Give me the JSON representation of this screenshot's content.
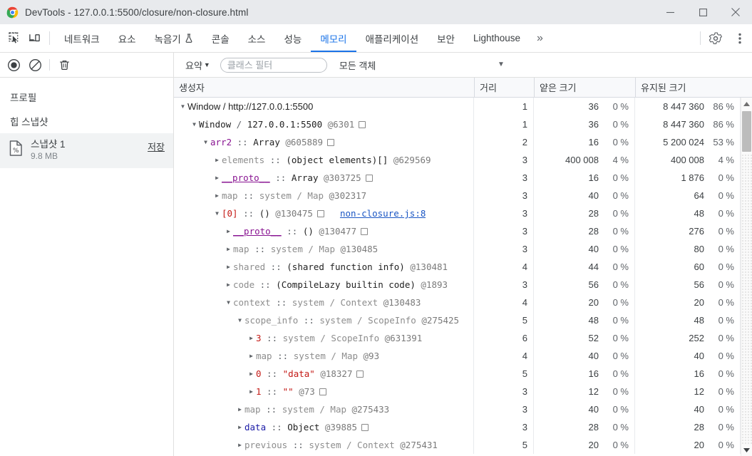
{
  "window": {
    "title": "DevTools - 127.0.0.1:5500/closure/non-closure.html",
    "minimize_label": "—",
    "maximize_label": "□",
    "close_label": "✕"
  },
  "tabbar": {
    "inspect_icon": "inspect-element-icon",
    "device_icon": "device-toolbar-icon",
    "tabs": [
      {
        "label": "네트워크",
        "active": false
      },
      {
        "label": "요소",
        "active": false
      },
      {
        "label": "녹음기",
        "active": false,
        "flask": true
      },
      {
        "label": "콘솔",
        "active": false
      },
      {
        "label": "소스",
        "active": false
      },
      {
        "label": "성능",
        "active": false
      },
      {
        "label": "메모리",
        "active": true
      },
      {
        "label": "애플리케이션",
        "active": false
      },
      {
        "label": "보안",
        "active": false
      },
      {
        "label": "Lighthouse",
        "active": false
      }
    ],
    "more_label": "»",
    "settings_icon": "gear-icon",
    "menu_icon": "more-vertical-icon"
  },
  "toolbar": {
    "record_icon": "record-icon",
    "clear_icon": "clear-icon",
    "trash_icon": "trash-icon",
    "view_select": "요약",
    "filter_placeholder": "클래스 필터",
    "filter_value": "",
    "object_select": "모든 객체",
    "caret": "▼"
  },
  "sidebar": {
    "profiles_title": "프로필",
    "section_title": "힙 스냅샷",
    "snapshot": {
      "icon": "snapshot-document-icon",
      "name": "스냅샷 1",
      "size": "9.8 MB",
      "save_label": "저장"
    }
  },
  "grid": {
    "columns": {
      "constructor": "생성자",
      "distance": "거리",
      "shallow": "얕은 크기",
      "retained": "유지된 크기"
    },
    "rows": [
      {
        "indent": 0,
        "twisty": "open",
        "topline": true,
        "parts": [
          {
            "t": "Window / http://127.0.0.1:5500",
            "c": "k-url"
          }
        ],
        "distance": "1",
        "shallow": "36",
        "shallow_pct": "0 %",
        "retained": "8 447 360",
        "retained_pct": "86 %"
      },
      {
        "indent": 1,
        "twisty": "open",
        "parts": [
          {
            "t": "Window",
            "c": "k-plain"
          },
          {
            "t": " / ",
            "c": "k-dim"
          },
          {
            "t": "127.0.0.1:5500",
            "c": "k-plain"
          },
          {
            "t": " @6301",
            "c": "k-id"
          },
          {
            "t": "box",
            "c": "winbox"
          }
        ],
        "distance": "1",
        "shallow": "36",
        "shallow_pct": "0 %",
        "retained": "8 447 360",
        "retained_pct": "86 %"
      },
      {
        "indent": 2,
        "twisty": "open",
        "parts": [
          {
            "t": "arr2",
            "c": "k-prop"
          },
          {
            "t": " :: ",
            "c": "k-dim"
          },
          {
            "t": "Array",
            "c": "k-plain"
          },
          {
            "t": " @605889",
            "c": "k-id"
          },
          {
            "t": "box",
            "c": "winbox"
          }
        ],
        "distance": "2",
        "shallow": "16",
        "shallow_pct": "0 %",
        "retained": "5 200 024",
        "retained_pct": "53 %"
      },
      {
        "indent": 3,
        "twisty": "closed",
        "parts": [
          {
            "t": "elements",
            "c": "k-sys"
          },
          {
            "t": " :: ",
            "c": "k-dim"
          },
          {
            "t": "(object elements)[]",
            "c": "k-plain"
          },
          {
            "t": " @629569",
            "c": "k-id"
          }
        ],
        "distance": "3",
        "shallow": "400 008",
        "shallow_pct": "4 %",
        "retained": "400 008",
        "retained_pct": "4 %"
      },
      {
        "indent": 3,
        "twisty": "closed",
        "parts": [
          {
            "t": "__proto__",
            "c": "k-prop-u"
          },
          {
            "t": " :: ",
            "c": "k-dim"
          },
          {
            "t": "Array",
            "c": "k-plain"
          },
          {
            "t": " @303725",
            "c": "k-id"
          },
          {
            "t": "box",
            "c": "winbox"
          }
        ],
        "distance": "3",
        "shallow": "16",
        "shallow_pct": "0 %",
        "retained": "1 876",
        "retained_pct": "0 %"
      },
      {
        "indent": 3,
        "twisty": "closed",
        "parts": [
          {
            "t": "map",
            "c": "k-sys"
          },
          {
            "t": " :: ",
            "c": "k-dim"
          },
          {
            "t": "system / Map",
            "c": "k-sys"
          },
          {
            "t": " @302317",
            "c": "k-id"
          }
        ],
        "distance": "3",
        "shallow": "40",
        "shallow_pct": "0 %",
        "retained": "64",
        "retained_pct": "0 %"
      },
      {
        "indent": 3,
        "twisty": "open",
        "parts": [
          {
            "t": "[0]",
            "c": "k-idx"
          },
          {
            "t": " :: ",
            "c": "k-dim"
          },
          {
            "t": "()",
            "c": "k-plain"
          },
          {
            "t": " @130475",
            "c": "k-id"
          },
          {
            "t": "box",
            "c": "winbox"
          },
          {
            "t": "non-closure.js:8",
            "c": "srclink"
          }
        ],
        "distance": "3",
        "shallow": "28",
        "shallow_pct": "0 %",
        "retained": "48",
        "retained_pct": "0 %"
      },
      {
        "indent": 4,
        "twisty": "closed",
        "parts": [
          {
            "t": "__proto__",
            "c": "k-prop-u"
          },
          {
            "t": " :: ",
            "c": "k-dim"
          },
          {
            "t": "()",
            "c": "k-plain"
          },
          {
            "t": " @130477",
            "c": "k-id"
          },
          {
            "t": "box",
            "c": "winbox"
          }
        ],
        "distance": "3",
        "shallow": "28",
        "shallow_pct": "0 %",
        "retained": "276",
        "retained_pct": "0 %"
      },
      {
        "indent": 4,
        "twisty": "closed",
        "parts": [
          {
            "t": "map",
            "c": "k-sys"
          },
          {
            "t": " :: ",
            "c": "k-dim"
          },
          {
            "t": "system / Map",
            "c": "k-sys"
          },
          {
            "t": " @130485",
            "c": "k-id"
          }
        ],
        "distance": "3",
        "shallow": "40",
        "shallow_pct": "0 %",
        "retained": "80",
        "retained_pct": "0 %"
      },
      {
        "indent": 4,
        "twisty": "closed",
        "parts": [
          {
            "t": "shared",
            "c": "k-sys"
          },
          {
            "t": " :: ",
            "c": "k-dim"
          },
          {
            "t": "(shared function info)",
            "c": "k-plain"
          },
          {
            "t": " @130481",
            "c": "k-id"
          }
        ],
        "distance": "4",
        "shallow": "44",
        "shallow_pct": "0 %",
        "retained": "60",
        "retained_pct": "0 %"
      },
      {
        "indent": 4,
        "twisty": "closed",
        "parts": [
          {
            "t": "code",
            "c": "k-sys"
          },
          {
            "t": " :: ",
            "c": "k-dim"
          },
          {
            "t": "(CompileLazy builtin code)",
            "c": "k-plain"
          },
          {
            "t": " @1893",
            "c": "k-id"
          }
        ],
        "distance": "3",
        "shallow": "56",
        "shallow_pct": "0 %",
        "retained": "56",
        "retained_pct": "0 %"
      },
      {
        "indent": 4,
        "twisty": "open",
        "parts": [
          {
            "t": "context",
            "c": "k-sys"
          },
          {
            "t": " :: ",
            "c": "k-dim"
          },
          {
            "t": "system / Context",
            "c": "k-sys"
          },
          {
            "t": " @130483",
            "c": "k-id"
          }
        ],
        "distance": "4",
        "shallow": "20",
        "shallow_pct": "0 %",
        "retained": "20",
        "retained_pct": "0 %"
      },
      {
        "indent": 5,
        "twisty": "open",
        "parts": [
          {
            "t": "scope_info",
            "c": "k-sys"
          },
          {
            "t": " :: ",
            "c": "k-dim"
          },
          {
            "t": "system / ScopeInfo",
            "c": "k-sys"
          },
          {
            "t": " @275425",
            "c": "k-id"
          }
        ],
        "distance": "5",
        "shallow": "48",
        "shallow_pct": "0 %",
        "retained": "48",
        "retained_pct": "0 %"
      },
      {
        "indent": 6,
        "twisty": "closed",
        "parts": [
          {
            "t": "3",
            "c": "k-idx"
          },
          {
            "t": " :: ",
            "c": "k-dim"
          },
          {
            "t": "system / ScopeInfo",
            "c": "k-sys"
          },
          {
            "t": " @631391",
            "c": "k-id"
          }
        ],
        "distance": "6",
        "shallow": "52",
        "shallow_pct": "0 %",
        "retained": "252",
        "retained_pct": "0 %"
      },
      {
        "indent": 6,
        "twisty": "closed",
        "parts": [
          {
            "t": "map",
            "c": "k-sys"
          },
          {
            "t": " :: ",
            "c": "k-dim"
          },
          {
            "t": "system / Map",
            "c": "k-sys"
          },
          {
            "t": " @93",
            "c": "k-id"
          }
        ],
        "distance": "4",
        "shallow": "40",
        "shallow_pct": "0 %",
        "retained": "40",
        "retained_pct": "0 %"
      },
      {
        "indent": 6,
        "twisty": "closed",
        "parts": [
          {
            "t": "0",
            "c": "k-idx"
          },
          {
            "t": " :: ",
            "c": "k-dim"
          },
          {
            "t": "\"data\"",
            "c": "k-str"
          },
          {
            "t": " @18327",
            "c": "k-id"
          },
          {
            "t": "box",
            "c": "winbox"
          }
        ],
        "distance": "5",
        "shallow": "16",
        "shallow_pct": "0 %",
        "retained": "16",
        "retained_pct": "0 %"
      },
      {
        "indent": 6,
        "twisty": "closed",
        "parts": [
          {
            "t": "1",
            "c": "k-idx"
          },
          {
            "t": " :: ",
            "c": "k-dim"
          },
          {
            "t": "\"\"",
            "c": "k-str"
          },
          {
            "t": " @73",
            "c": "k-id"
          },
          {
            "t": "box",
            "c": "winbox"
          }
        ],
        "distance": "3",
        "shallow": "12",
        "shallow_pct": "0 %",
        "retained": "12",
        "retained_pct": "0 %"
      },
      {
        "indent": 5,
        "twisty": "closed",
        "parts": [
          {
            "t": "map",
            "c": "k-sys"
          },
          {
            "t": " :: ",
            "c": "k-dim"
          },
          {
            "t": "system / Map",
            "c": "k-sys"
          },
          {
            "t": " @275433",
            "c": "k-id"
          }
        ],
        "distance": "3",
        "shallow": "40",
        "shallow_pct": "0 %",
        "retained": "40",
        "retained_pct": "0 %"
      },
      {
        "indent": 5,
        "twisty": "closed",
        "parts": [
          {
            "t": "data",
            "c": "k-obj"
          },
          {
            "t": " :: ",
            "c": "k-dim"
          },
          {
            "t": "Object",
            "c": "k-plain"
          },
          {
            "t": " @39885",
            "c": "k-id"
          },
          {
            "t": "box",
            "c": "winbox"
          }
        ],
        "distance": "3",
        "shallow": "28",
        "shallow_pct": "0 %",
        "retained": "28",
        "retained_pct": "0 %"
      },
      {
        "indent": 5,
        "twisty": "closed",
        "parts": [
          {
            "t": "previous",
            "c": "k-sys"
          },
          {
            "t": " :: ",
            "c": "k-dim"
          },
          {
            "t": "system / Context",
            "c": "k-sys"
          },
          {
            "t": " @275431",
            "c": "k-id"
          }
        ],
        "distance": "5",
        "shallow": "20",
        "shallow_pct": "0 %",
        "retained": "20",
        "retained_pct": "0 %"
      }
    ]
  }
}
